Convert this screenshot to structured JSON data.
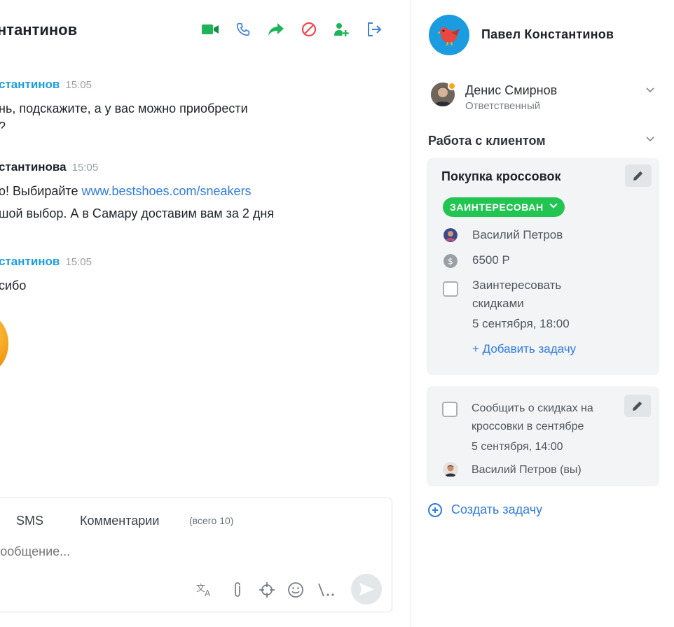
{
  "chat": {
    "title": "нтантинов",
    "messages": [
      {
        "author": "стантинов",
        "time": "15:05",
        "lines": [
          "нь, подскажите, а у вас можно приобрести",
          "?"
        ]
      },
      {
        "author": "стантинова",
        "time": "15:05",
        "line1_prefix": "о! Выбирайте ",
        "line1_link": "www.bestshoes.com/sneakers",
        "line2": "шой выбор. А в Самару доставим вам за 2 дня"
      },
      {
        "author": "стантинов",
        "time": "15:05",
        "lines": [
          "сибо"
        ]
      }
    ],
    "composer": {
      "tabs": [
        "SMS",
        "Комментарии"
      ],
      "comments_count": "(всего 10)",
      "placeholder": "сообщение..."
    }
  },
  "panel": {
    "client_name": "Павел Константинов",
    "responsible": {
      "name": "Денис Смирнов",
      "role": "Ответственный"
    },
    "section_title": "Работа с клиентом",
    "deal": {
      "title": "Покупка кроссовок",
      "status": "ЗАИНТЕРЕСОВАН",
      "manager": "Василий Петров",
      "amount": "6500 Р",
      "task_title_line1": "Заинтересовать",
      "task_title_line2": "скидками",
      "task_date": "5 сентября, 18:00",
      "add_task": "+ Добавить задачу"
    },
    "task": {
      "title_line1": "Сообщить о скидках на",
      "title_line2": "кроссовки в сентябре",
      "date": "5 сентября, 14:00",
      "assignee": "Василий Петров (вы)"
    },
    "create_task": "Создать задачу"
  },
  "colors": {
    "accent_blue": "#2f7be0",
    "author_blue": "#1a9ee0",
    "status_green": "#23c552",
    "video_green": "#1fb35a",
    "block_red": "#f0484f"
  }
}
